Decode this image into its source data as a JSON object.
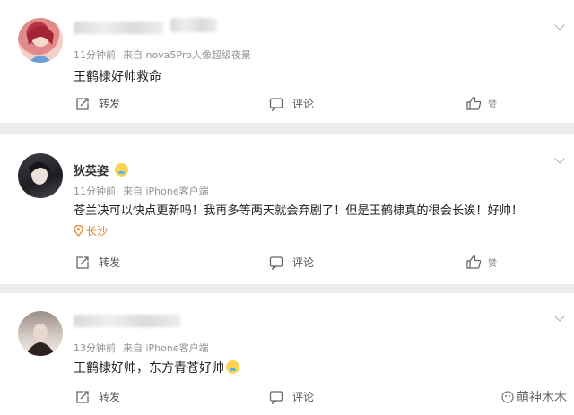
{
  "comments": [
    {
      "username": "",
      "time": "11分钟前",
      "source": "来自 nova5Pro人像超级夜景",
      "content": "王鹤棣好帅救命",
      "location": ""
    },
    {
      "username": "狄英姿",
      "time": "11分钟前",
      "source": "来自 iPhone客户端",
      "content": "苍兰决可以快点更新吗！我再多等两天就会弃剧了！但是王鹤棣真的很会长诶！好帅！",
      "location": "长沙"
    },
    {
      "username": "",
      "time": "13分钟前",
      "source": "来自 iPhone客户端",
      "content": "王鹤棣好帅，东方青苍好帅",
      "location": ""
    }
  ],
  "actions": {
    "repost": "转发",
    "comment": "评论",
    "like_count": "赞"
  },
  "watermark": "萌神木木",
  "colors": {
    "location": "#e8812b",
    "meta": "#939393",
    "background": "#ededed"
  },
  "icons": {
    "repost": "share-square-arrow",
    "comment": "speech-bubble",
    "like": "thumbs-up",
    "location": "map-pin",
    "more": "chevron-down"
  }
}
